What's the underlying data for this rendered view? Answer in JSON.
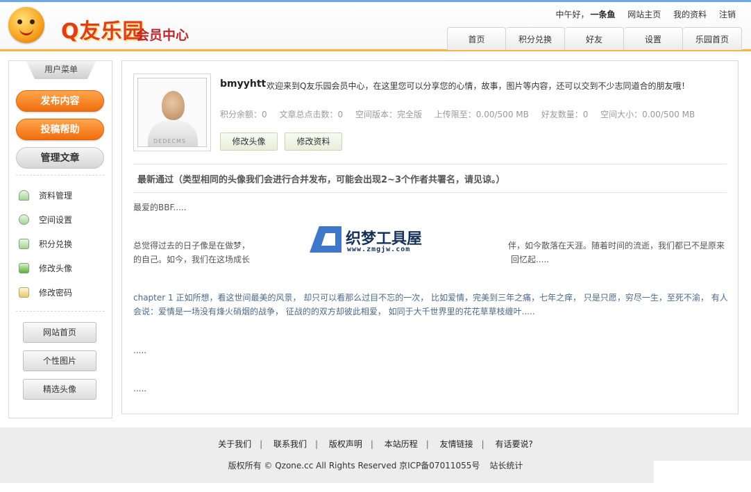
{
  "header": {
    "logo_brand": "Q友乐园",
    "logo_sub": "会员中心",
    "greeting": "中午好，",
    "username": "一条鱼",
    "links": [
      "网站主页",
      "我的资料",
      "注销"
    ],
    "tabs": [
      "首页",
      "积分兑换",
      "好友",
      "设置",
      "乐园首页"
    ]
  },
  "sidebar": {
    "title": "用户菜单",
    "primary_buttons": [
      "发布内容",
      "投稿帮助"
    ],
    "secondary_button": "管理文章",
    "items": [
      "资料管理",
      "空间设置",
      "积分兑换",
      "修改头像",
      "修改密码"
    ],
    "bottom_buttons": [
      "网站首页",
      "个性图片",
      "精选头像"
    ]
  },
  "profile": {
    "username": "bmyyhtt",
    "avatar_caption": "DEDECMS",
    "welcome": "欢迎来到Q友乐园会员中心，在这里您可以分享您的心情，故事，图片等内容，还可以交到不少志同道合的朋友哦！",
    "stats": [
      "积分余额：0",
      "文章总点击数：0",
      "空间版本：完全版",
      "上传限至：0.00/500 MB",
      "好友数量：0",
      "空间大小：0.00/500 MB"
    ],
    "edit_avatar": "修改头像",
    "edit_profile": "修改资料"
  },
  "content": {
    "section_title": "最新通过（类型相同的头像我们会进行合并发布，可能会出现2~3个作者共署名，请见谅。）",
    "para1": "最爱的BBF.....",
    "para2_left": "总觉得过去的日子像是在做梦，",
    "para2_right": "伴，如今散落在天涯。随着时间的流逝，我们都已不是原来",
    "para2b_left": "的自己。如今，我们在这场成长",
    "para2b_right": "回忆起.....",
    "para3a": "chapter 1 正如所想，看这世间最美的风景，  却只可以看那么过目不忘的一次，  比如爱情，完美到三年之痛，七年之痒，  只是只愿，穷尽一生，至死不渝，  有人",
    "para3b": "会说：爱情是一场没有烽火硝烟的战争，  征战的的双方却彼此相爱，  如同于大千世界里的花花草草枝缠叶.....",
    "para4": ".....",
    "para5": "....."
  },
  "watermark": {
    "title": "织梦工具屋",
    "url": "www.zmgjw.com"
  },
  "footer": {
    "links": [
      "关于我们",
      "联系我们",
      "版权声明",
      "本站历程",
      "友情链接",
      "有话要说?"
    ],
    "separator": "|",
    "copyright": "版权所有 © Qzone.cc All Rights Reserved 京ICP备07011055号",
    "stats": "站长统计"
  }
}
